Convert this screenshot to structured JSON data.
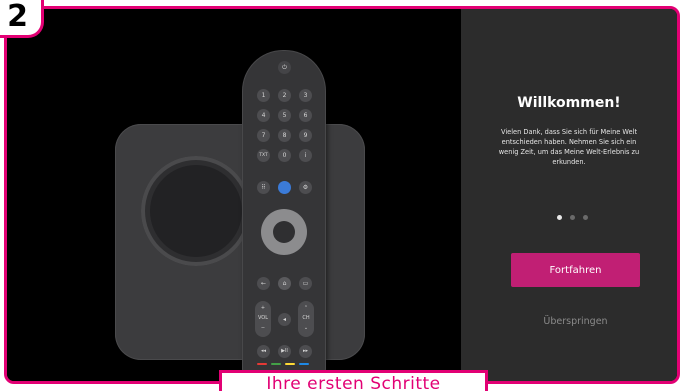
{
  "step": {
    "number": "2"
  },
  "welcome": {
    "title": "Willkommen!",
    "body": "Vielen Dank, dass Sie sich für Meine Welt entschieden haben. Nehmen Sie sich ein wenig Zeit, um das Meine Welt-Erlebnis zu erkunden.",
    "pagination": {
      "total": 3,
      "current": 1
    },
    "primary_button": "Fortfahren",
    "secondary_button": "Überspringen"
  },
  "caption": {
    "text": "Ihre ersten Schritte"
  },
  "remote": {
    "keys": [
      "1",
      "2",
      "3",
      "4",
      "5",
      "6",
      "7",
      "8",
      "9",
      "TXT",
      "0",
      "i"
    ],
    "vol_label": "VOL",
    "ch_label": "CH",
    "play_label": "▶II"
  },
  "colors": {
    "accent": "#e20074",
    "primary_button": "#c11f74",
    "panel_bg": "#2c2c2c",
    "color_keys": [
      "#e53935",
      "#43a047",
      "#fdd835",
      "#1e88e5"
    ]
  }
}
